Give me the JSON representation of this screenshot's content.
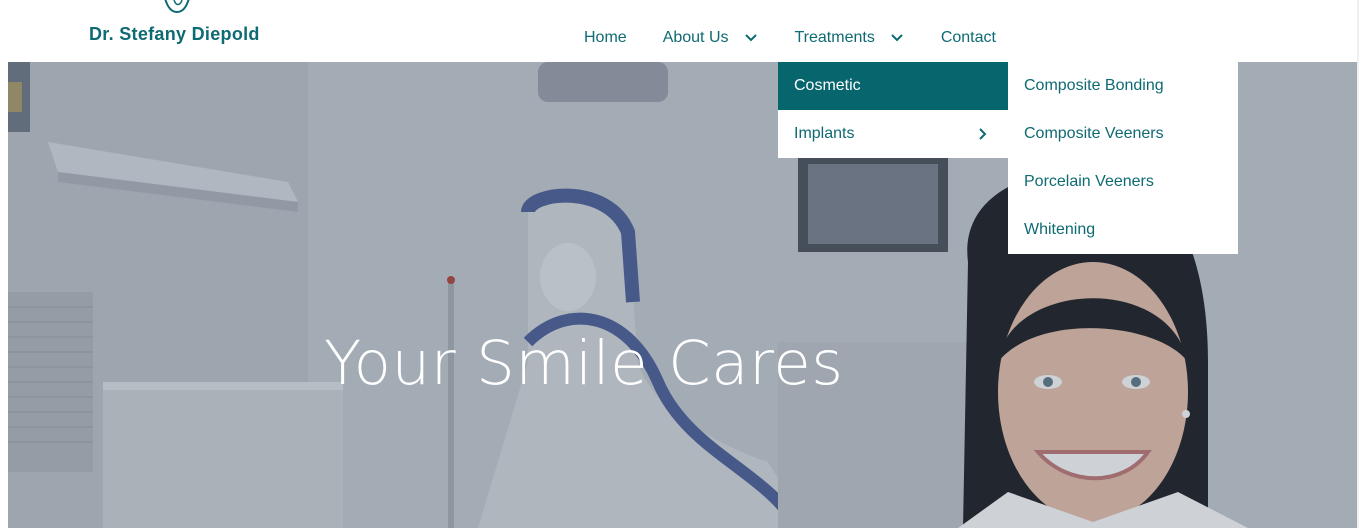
{
  "brand": {
    "name": "Dr. Stefany Diepold",
    "color": "#0e6a73"
  },
  "nav": {
    "home": "Home",
    "about": "About Us",
    "treatments": "Treatments",
    "contact": "Contact"
  },
  "dropdown": {
    "level1": [
      {
        "label": "Cosmetic",
        "active": true
      },
      {
        "label": "Implants",
        "has_submenu": true
      }
    ],
    "level2": [
      {
        "label": "Composite Bonding"
      },
      {
        "label": "Composite Veeners"
      },
      {
        "label": "Porcelain Veeners"
      },
      {
        "label": "Whitening"
      }
    ],
    "active_bg": "#07656d"
  },
  "hero": {
    "title": "Your Smile Cares"
  }
}
